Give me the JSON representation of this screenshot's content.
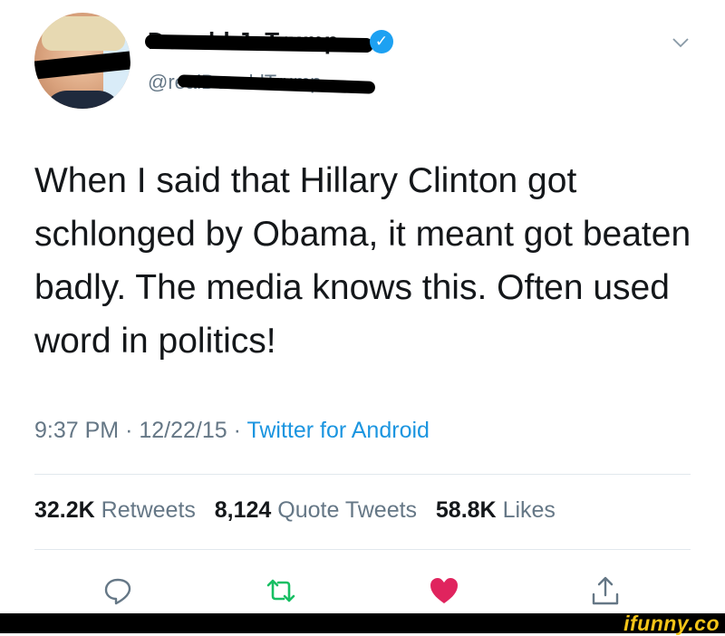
{
  "header": {
    "display_name": "Donald J. Trump",
    "handle": "@realDonaldTrump",
    "verified_icon": "verified-badge-icon",
    "menu_icon": "chevron-down-icon"
  },
  "tweet": {
    "text": "When I said that Hillary Clinton got schlonged by Obama, it meant got beaten badly. The media knows this. Often used word in politics!",
    "time": "9:37 PM",
    "date": "12/22/15",
    "source": "Twitter for Android",
    "separator": "·"
  },
  "stats": {
    "retweets_count": "32.2K",
    "retweets_label": "Retweets",
    "quote_count": "8,124",
    "quote_label": "Quote Tweets",
    "likes_count": "58.8K",
    "likes_label": "Likes"
  },
  "actions": [
    "reply-icon",
    "retweet-icon",
    "like-icon",
    "share-icon"
  ],
  "colors": {
    "text": "#14171a",
    "secondary": "#657786",
    "link": "#1b95e0",
    "verified": "#1da1f2",
    "retweet": "#17bf63",
    "like": "#e0245e"
  },
  "watermark": "ifunny.co"
}
